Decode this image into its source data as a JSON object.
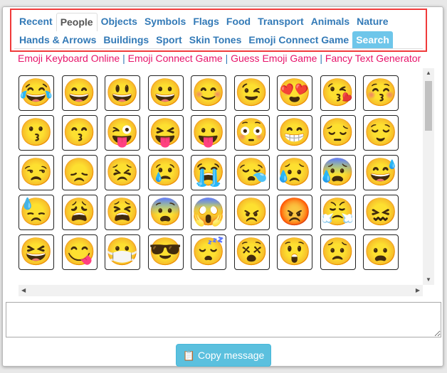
{
  "tabs_row1": [
    "Recent",
    "People",
    "Objects",
    "Symbols",
    "Flags",
    "Food",
    "Transport",
    "Animals",
    "Nature"
  ],
  "tabs_row2": [
    "Hands & Arrows",
    "Buildings",
    "Sport",
    "Skin Tones",
    "Emoji Connect Game",
    "Search"
  ],
  "active_tab": "People",
  "links": [
    "Emoji Keyboard Online",
    "Emoji Connect Game",
    "Guess Emoji Game",
    "Fancy Text Generator"
  ],
  "link_separator": "|",
  "emoji_rows": [
    [
      "😂",
      "😄",
      "😃",
      "😀",
      "😊",
      "😉",
      "😍",
      "😘",
      "😚"
    ],
    [
      "😗",
      "😙",
      "😜",
      "😝",
      "😛",
      "😳",
      "😁",
      "😔",
      "😌"
    ],
    [
      "😒",
      "😞",
      "😣",
      "😢",
      "😭",
      "😪",
      "😥",
      "😰",
      "😅"
    ],
    [
      "😓",
      "😩",
      "😫",
      "😨",
      "😱",
      "😠",
      "😡",
      "😤",
      "😖"
    ],
    [
      "😆",
      "😋",
      "😷",
      "😎",
      "😴",
      "😵",
      "😲",
      "😟",
      "😦"
    ],
    [
      "😧",
      "😈",
      "👿",
      "😮",
      "😬",
      "😐",
      "😕",
      "😯",
      "😶"
    ]
  ],
  "message": {
    "value": "",
    "placeholder": ""
  },
  "copy_button": {
    "label": "Copy message",
    "icon": "clipboard-icon"
  },
  "colors": {
    "accent": "#337ab7",
    "link": "#e8136a",
    "search_tab": "#6ec6ea",
    "copy_button": "#5bc0de",
    "highlight_border": "#f03a3a"
  }
}
